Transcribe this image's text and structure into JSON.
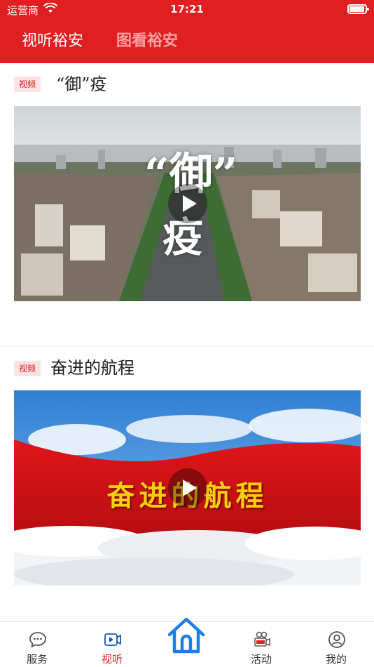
{
  "status_bar": {
    "carrier": "运营商",
    "time": "17:21"
  },
  "header": {
    "tabs": [
      {
        "label": "视听裕安",
        "active": true
      },
      {
        "label": "图看裕安",
        "active": false
      }
    ],
    "accent_color": "#e02020"
  },
  "feed": [
    {
      "badge": "视频",
      "title": "“御”疫",
      "thumbnail": {
        "overlay_line1": "“御”",
        "overlay_line2": "疫",
        "scene": "aerial city street"
      }
    },
    {
      "badge": "视频",
      "title": "奋进的航程",
      "thumbnail": {
        "overlay": "奋进的航程",
        "scene": "red flag over clouds"
      }
    }
  ],
  "bottom_nav": {
    "items": [
      {
        "label": "服务",
        "icon": "chat-icon",
        "active": false
      },
      {
        "label": "视听",
        "icon": "video-icon",
        "active": true
      },
      {
        "label": "",
        "icon": "home-icon",
        "active": false
      },
      {
        "label": "活动",
        "icon": "live-camera-icon",
        "active": false
      },
      {
        "label": "我的",
        "icon": "user-icon",
        "active": false
      }
    ]
  }
}
